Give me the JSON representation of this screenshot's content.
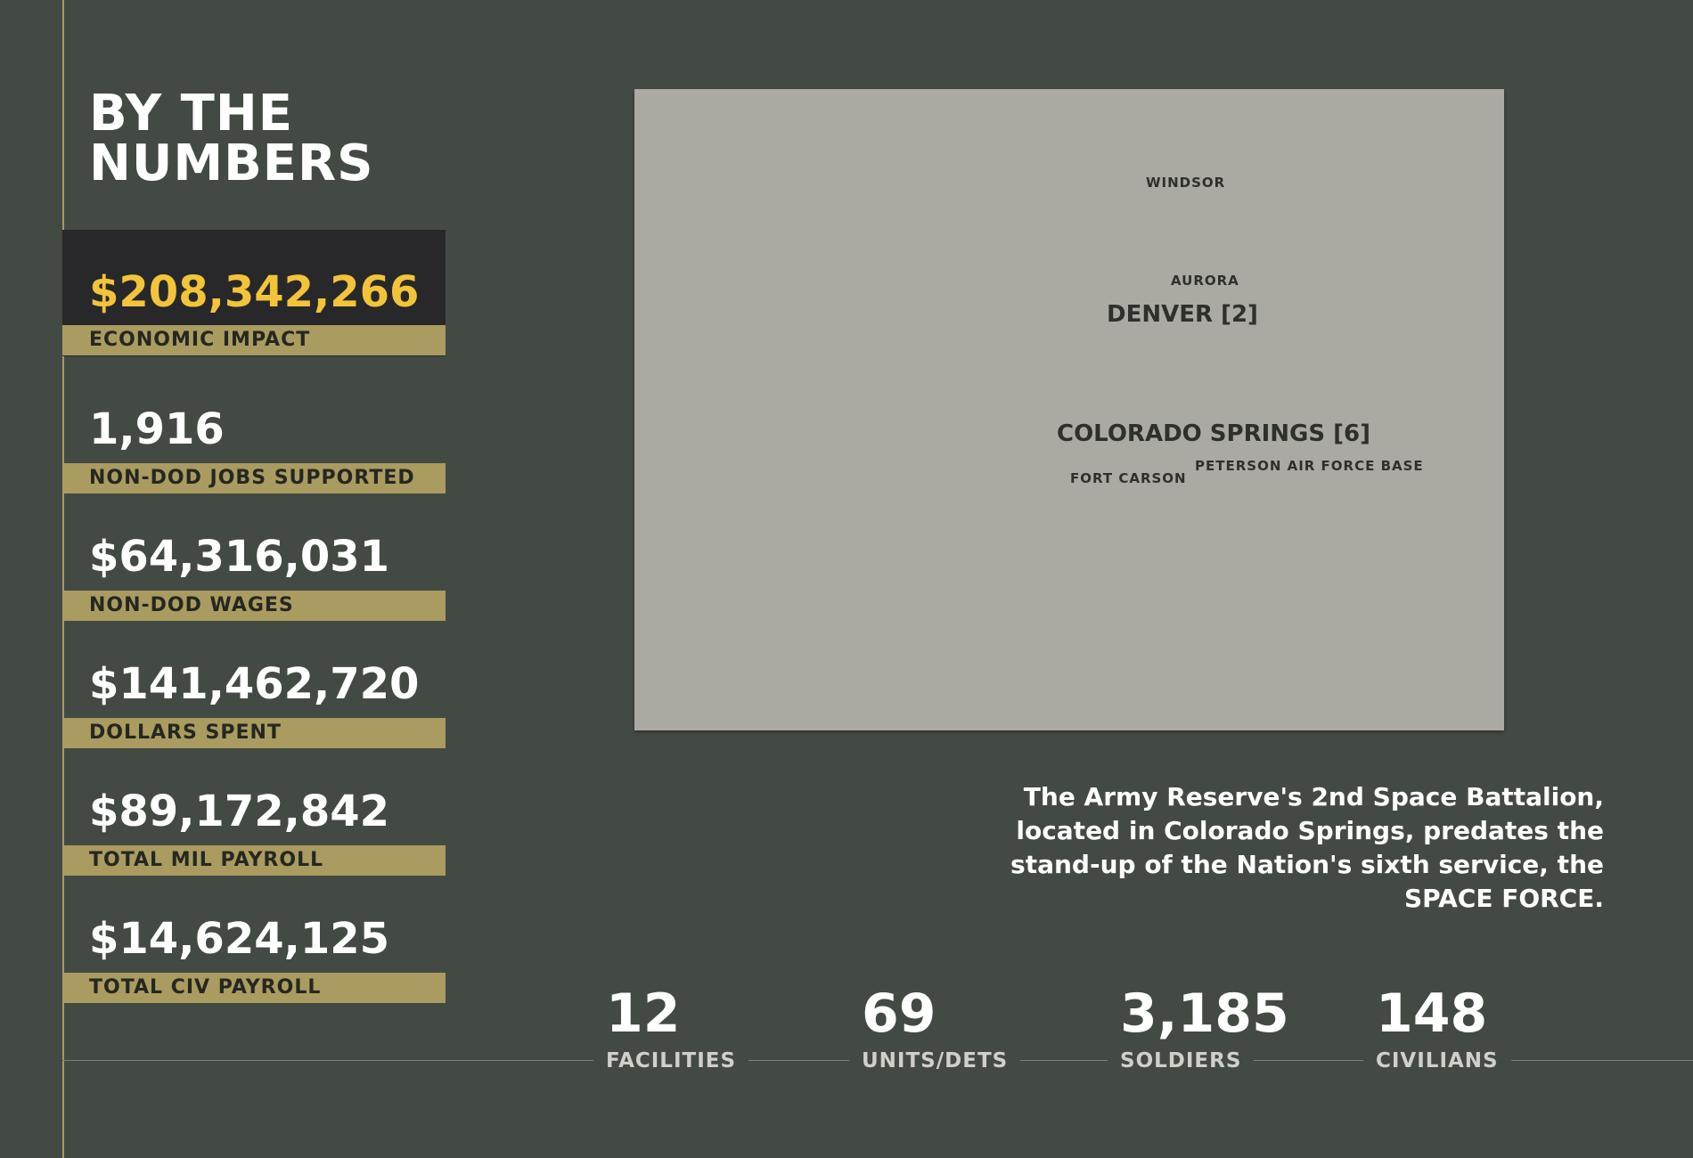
{
  "page": {
    "title": "BY THE\nNUMBERS",
    "colors": {
      "background": "#434a43",
      "gold": "#aa9b60",
      "highlight_value": "#f2c43a",
      "map": "#abaaa2"
    }
  },
  "stats": [
    {
      "value": "$208,342,266",
      "label": "ECONOMIC IMPACT"
    },
    {
      "value": "1,916",
      "label": "NON-DOD JOBS SUPPORTED"
    },
    {
      "value": "$64,316,031",
      "label": "NON-DOD WAGES"
    },
    {
      "value": "$141,462,720",
      "label": "DOLLARS SPENT"
    },
    {
      "value": "$89,172,842",
      "label": "TOTAL MIL PAYROLL"
    },
    {
      "value": "$14,624,125",
      "label": "TOTAL CIV PAYROLL"
    }
  ],
  "map": {
    "cities": {
      "windsor": "WINDSOR",
      "aurora": "AURORA",
      "denver": "DENVER [2]",
      "colorado_springs": "COLORADO SPRINGS [6]",
      "peterson": "PETERSON AIR FORCE BASE",
      "fort_carson": "FORT CARSON"
    }
  },
  "caption": "The Army Reserve's 2nd Space Battalion, located in Colorado Springs, predates the stand-up of the Nation's sixth service, the SPACE FORCE.",
  "counts": [
    {
      "value": "12",
      "label": "FACILITIES"
    },
    {
      "value": "69",
      "label": "UNITS/DETS"
    },
    {
      "value": "3,185",
      "label": "SOLDIERS"
    },
    {
      "value": "148",
      "label": "CIVILIANS"
    }
  ]
}
